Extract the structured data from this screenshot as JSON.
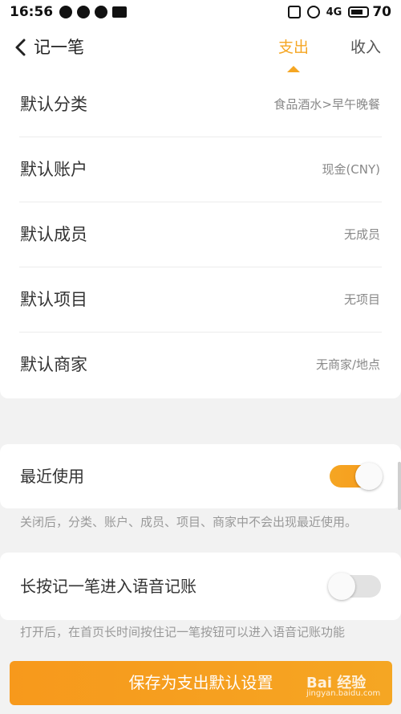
{
  "status_bar": {
    "time": "16:56",
    "battery": "70",
    "signal": "4G"
  },
  "header": {
    "title": "记一笔",
    "tabs": [
      {
        "label": "支出",
        "active": true
      },
      {
        "label": "收入",
        "active": false
      }
    ]
  },
  "defaults": [
    {
      "label": "默认分类",
      "value": "食品酒水>早午晚餐"
    },
    {
      "label": "默认账户",
      "value": "现金(CNY)"
    },
    {
      "label": "默认成员",
      "value": "无成员"
    },
    {
      "label": "默认项目",
      "value": "无项目"
    },
    {
      "label": "默认商家",
      "value": "无商家/地点"
    }
  ],
  "recent_use": {
    "label": "最近使用",
    "enabled": true,
    "hint": "关闭后，分类、账户、成员、项目、商家中不会出现最近使用。"
  },
  "voice_entry": {
    "label": "长按记一笔进入语音记账",
    "enabled": false,
    "hint": "打开后，在首页长时间按住记一笔按钮可以进入语音记账功能"
  },
  "save_button": "保存为支出默认设置",
  "watermark": {
    "text": "Bai 经验",
    "url": "jingyan.baidu.com"
  },
  "colors": {
    "accent": "#f5a623",
    "toggle_on": "#f89a1c",
    "toggle_off": "#e2e2e2"
  }
}
